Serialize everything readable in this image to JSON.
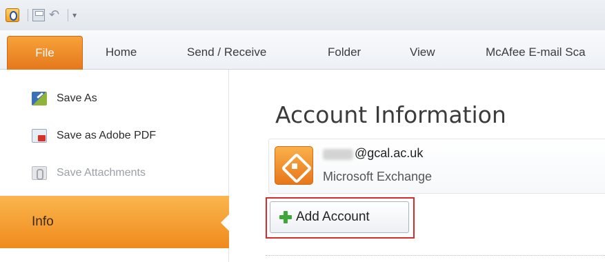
{
  "quick_access": {
    "app_icon": "outlook-icon",
    "save_icon": "save-icon",
    "undo_icon": "undo-icon",
    "undo_glyph": "↶",
    "customize_glyph": "▾"
  },
  "ribbon": {
    "tabs": [
      {
        "label": "File"
      },
      {
        "label": "Home"
      },
      {
        "label": "Send / Receive"
      },
      {
        "label": "Folder"
      },
      {
        "label": "View"
      },
      {
        "label": "McAfee E-mail Sca"
      }
    ]
  },
  "sidebar": {
    "items": [
      {
        "label": "Save As",
        "icon": "save-as-icon"
      },
      {
        "label": "Save as Adobe PDF",
        "icon": "pdf-icon"
      },
      {
        "label": "Save Attachments",
        "icon": "attachment-icon"
      }
    ],
    "active": {
      "label": "Info"
    }
  },
  "main": {
    "title": "Account Information",
    "account": {
      "email": "@gcal.ac.uk",
      "type": "Microsoft Exchange",
      "icon": "exchange-icon"
    },
    "add_account_label": "Add Account"
  },
  "colors": {
    "file_tab": "#E5781B",
    "info_active": "#F08A1D",
    "highlight": "#D92B2B",
    "plus": "#3EA63A"
  }
}
